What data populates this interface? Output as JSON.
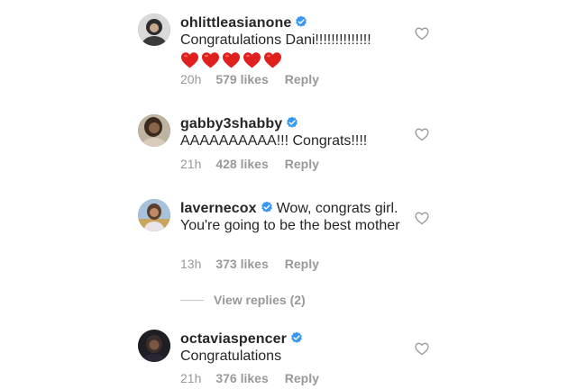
{
  "comments": [
    {
      "username": "ohlittleasianone",
      "text": "Congratulations Dani!!!!!!!!!!!!!!",
      "emoji": [
        "red-heart",
        "red-heart",
        "red-heart",
        "red-heart",
        "red-heart"
      ],
      "time": "20h",
      "likes": "579 likes",
      "reply": "Reply",
      "verified": true,
      "avatar_color": "#2b2b2b"
    },
    {
      "username": "gabby3shabby",
      "text": "AAAAAAAAAA!!! Congrats!!!!",
      "time": "21h",
      "likes": "428 likes",
      "reply": "Reply",
      "verified": true,
      "avatar_color": "#6b5a45"
    },
    {
      "username": "lavernecox",
      "text": "Wow, congrats girl. You're going to  be the best mother",
      "time": "13h",
      "likes": "373 likes",
      "reply": "Reply",
      "verified": true,
      "avatar_color": "#8fa8c8"
    },
    {
      "username": "octaviaspencer",
      "text": "Congratulations",
      "time": "21h",
      "likes": "376 likes",
      "reply": "Reply",
      "verified": true,
      "avatar_color": "#1e1e24"
    }
  ],
  "view_replies": "View replies (2)",
  "colors": {
    "text": "#262626",
    "meta": "#999999",
    "verified_badge": "#3897f0",
    "heart_outline": "#c7c7c7",
    "emoji_heart": "#e0201e"
  },
  "icons": {
    "like": "heart-outline-icon",
    "verified": "verified-badge-icon"
  }
}
